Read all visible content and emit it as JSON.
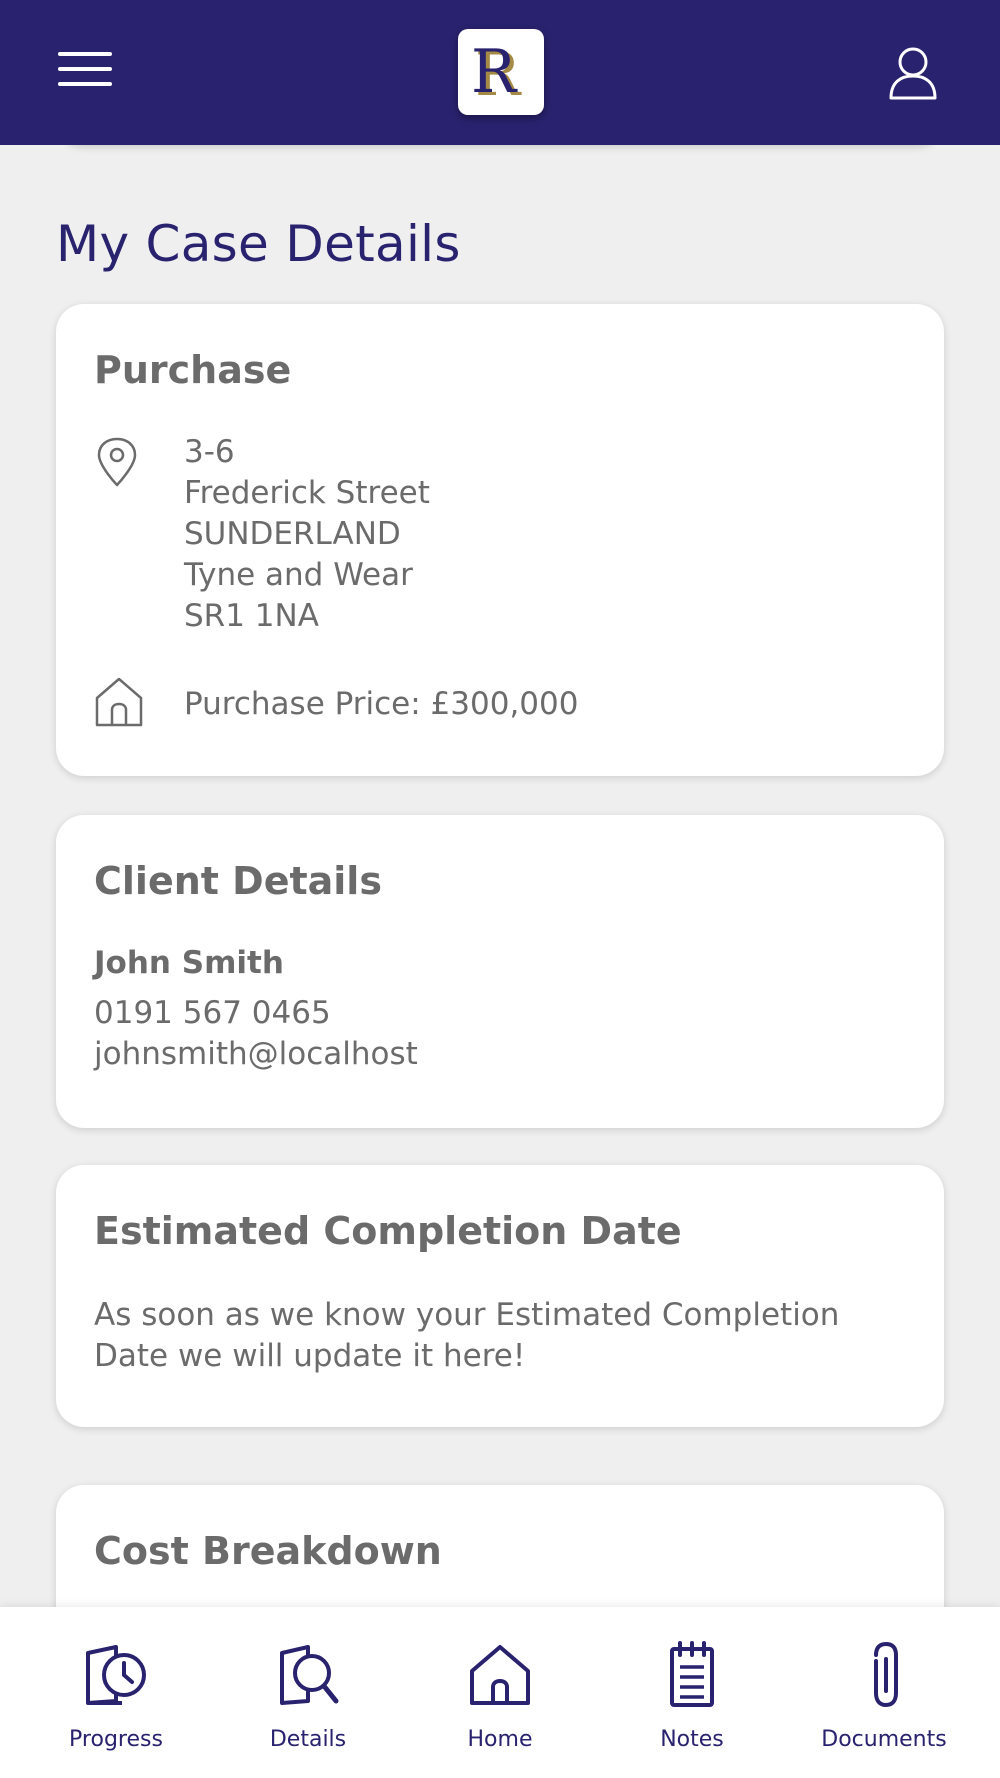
{
  "header": {
    "logo_letter": "R",
    "menu_icon": "hamburger-menu-icon",
    "profile_icon": "user-profile-icon"
  },
  "page": {
    "title": "My Case Details"
  },
  "purchase_card": {
    "title": "Purchase",
    "address_icon": "map-pin-icon",
    "address_lines": [
      "3-6",
      "Frederick Street",
      "SUNDERLAND",
      "Tyne and Wear",
      "SR1 1NA"
    ],
    "price_icon": "house-icon",
    "price_text": "Purchase Price: £300,000"
  },
  "client_card": {
    "title": "Client Details",
    "name": "John Smith",
    "phone": "0191 567 0465",
    "email": "johnsmith@localhost"
  },
  "completion_card": {
    "title": "Estimated Completion Date",
    "message": "As soon as we know your Estimated Completion Date we will update it here!"
  },
  "cost_card": {
    "title": "Cost Breakdown"
  },
  "bottom_nav": {
    "items": [
      {
        "label": "Progress",
        "icon": "progress-clock-icon"
      },
      {
        "label": "Details",
        "icon": "details-search-icon"
      },
      {
        "label": "Home",
        "icon": "home-icon"
      },
      {
        "label": "Notes",
        "icon": "notepad-icon"
      },
      {
        "label": "Documents",
        "icon": "paperclip-icon"
      }
    ]
  },
  "colors": {
    "brand": "#29226e",
    "logo_gold": "#a48a45",
    "background": "#efefef",
    "card_text": "#6b6b6b"
  }
}
